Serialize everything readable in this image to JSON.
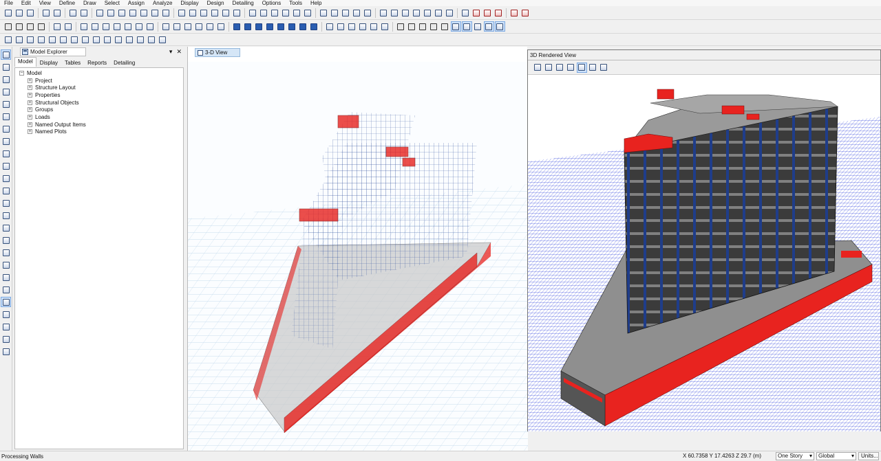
{
  "menu": [
    "File",
    "Edit",
    "View",
    "Define",
    "Draw",
    "Select",
    "Assign",
    "Analyze",
    "Display",
    "Design",
    "Detailing",
    "Options",
    "Tools",
    "Help"
  ],
  "explorer": {
    "title": "Model Explorer",
    "pin": "▾",
    "close": "✕",
    "tabs": [
      "Model",
      "Display",
      "Tables",
      "Reports",
      "Detailing"
    ],
    "root": "Model",
    "items": [
      "Project",
      "Structure Layout",
      "Properties",
      "Structural Objects",
      "Groups",
      "Loads",
      "Named Output Items",
      "Named Plots"
    ]
  },
  "view3d": {
    "tab_label": "3-D View"
  },
  "render_window": {
    "title": "3D Rendered View"
  },
  "status": {
    "message": "Processing Walls",
    "coordinates": "X 60.7358  Y 17.4263  Z 29.7 (m)",
    "story_option": "One Story",
    "coord_system": "Global",
    "units_button": "Units..."
  },
  "colors": {
    "accent": "#2a5db0",
    "wall_red": "#e8231f",
    "slab_grey": "#9a9a9a",
    "frame_blue": "#1f3d8a",
    "ground_blue": "#1a2fd8"
  },
  "toolbar_icons": [
    "new-model-icon",
    "open-icon",
    "save-icon",
    "undo-icon",
    "redo-icon",
    "pointer-icon",
    "zoom-in-icon",
    "zoom-out-icon",
    "pan-icon",
    "rotate-icon",
    "3d-view-icon",
    "plan-view-icon",
    "elevation-view-icon",
    "run-analysis-icon",
    "design-icon"
  ]
}
